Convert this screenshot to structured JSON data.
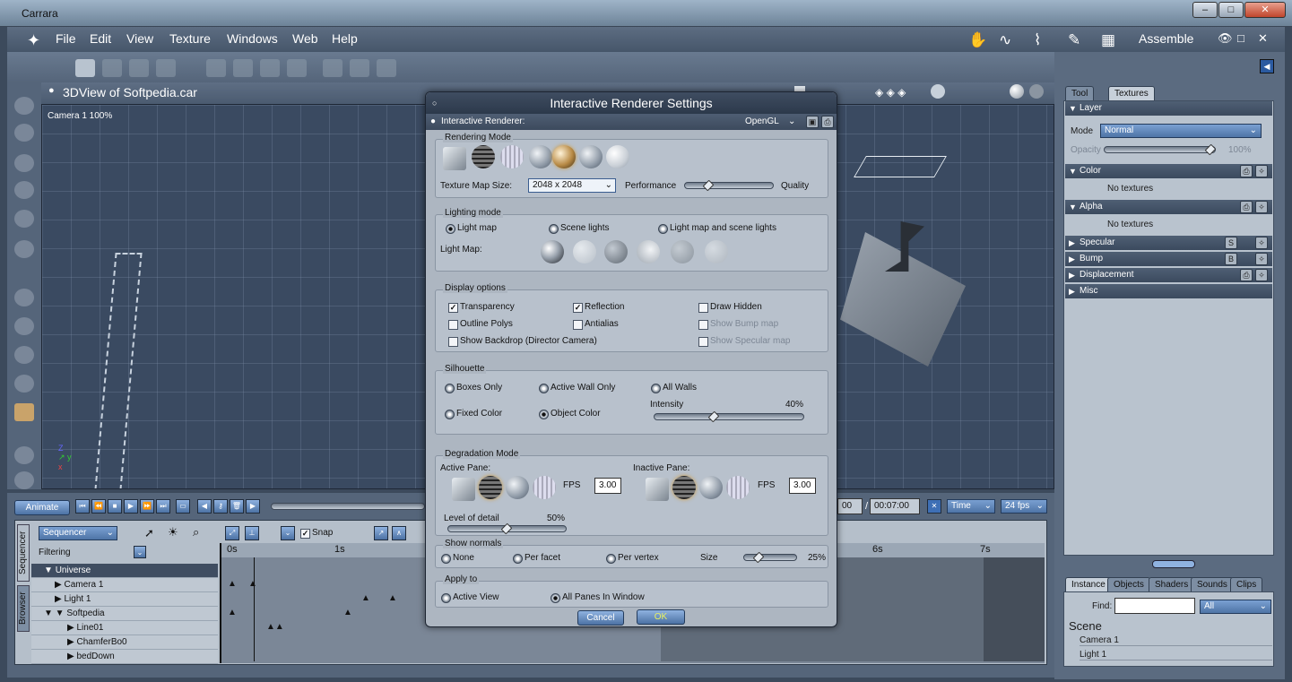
{
  "window": {
    "title": "Carrara",
    "min": "–",
    "max": "□",
    "close": "✕"
  },
  "menu": [
    "File",
    "Edit",
    "View",
    "Texture",
    "Windows",
    "Web",
    "Help"
  ],
  "room": {
    "label": "Assemble"
  },
  "view": {
    "title": "3DView of Softpedia.car",
    "camera": "Camera 1 100%"
  },
  "dialog": {
    "title": "Interactive Renderer Settings",
    "renderer_label": "Interactive Renderer:",
    "renderer_value": "OpenGL",
    "rendering_mode": {
      "label": "Rendering Mode",
      "texture_map_label": "Texture Map Size:",
      "texture_map_value": "2048 x  2048",
      "performance": "Performance",
      "quality": "Quality"
    },
    "lighting": {
      "label": "Lighting mode",
      "opt1": "Light map",
      "opt2": "Scene lights",
      "opt3": "Light map and scene lights",
      "lightmap_label": "Light Map:"
    },
    "display": {
      "label": "Display options",
      "transparency": "Transparency",
      "reflection": "Reflection",
      "draw_hidden": "Draw Hidden",
      "outline_polys": "Outline Polys",
      "antialias": "Antialias",
      "show_bump": "Show Bump map",
      "show_backdrop": "Show Backdrop (Director Camera)",
      "show_specular": "Show Specular map"
    },
    "silhouette": {
      "label": "Silhouette",
      "boxes_only": "Boxes Only",
      "active_wall": "Active Wall Only",
      "all_walls": "All Walls",
      "fixed_color": "Fixed Color",
      "object_color": "Object Color",
      "intensity_label": "Intensity",
      "intensity_value": "40%",
      "intensity": 0.4
    },
    "degradation": {
      "label": "Degradation Mode",
      "active_pane": "Active Pane:",
      "inactive_pane": "Inactive Pane:",
      "fps_label": "FPS",
      "fps_active": "3.00",
      "fps_inactive": "3.00",
      "lod_label": "Level of detail",
      "lod_value": "50%",
      "lod": 0.5
    },
    "normals": {
      "label": "Show normals",
      "none": "None",
      "per_facet": "Per facet",
      "per_vertex": "Per vertex",
      "size_label": "Size",
      "size_value": "25%",
      "size": 0.25
    },
    "apply": {
      "label": "Apply to",
      "active_view": "Active View",
      "all_panes": "All Panes In Window"
    },
    "cancel": "Cancel",
    "ok": "OK"
  },
  "texture_panel": {
    "tabs": [
      "Tool",
      "Textures"
    ],
    "layer": "Layer",
    "mode_label": "Mode",
    "mode_value": "Normal",
    "opacity_label": "Opacity",
    "opacity_value": "100%",
    "color": "Color",
    "alpha": "Alpha",
    "no_textures": "No textures",
    "specular": "Specular",
    "bump": "Bump",
    "displacement": "Displacement",
    "misc": "Misc",
    "specular_key": "S",
    "bump_key": "B"
  },
  "instance_panel": {
    "tabs": [
      "Instance",
      "Objects",
      "Shaders",
      "Sounds",
      "Clips"
    ],
    "find_label": "Find:",
    "find_value": "",
    "filter": "All",
    "scene_title": "Scene",
    "items": [
      "Camera 1",
      "Light 1"
    ]
  },
  "timeline": {
    "animate": "Animate",
    "sequencer": "Sequencer",
    "filtering": "Filtering",
    "snap": "Snap",
    "time_a": "00",
    "time_b": "00:07:00",
    "time_mode": "Time",
    "fps": "24 fps",
    "ruler": [
      "0s",
      "1s",
      "6s",
      "7s"
    ],
    "side_tabs": [
      "Sequencer",
      "Browser"
    ],
    "tree": [
      "Universe",
      "Camera 1",
      "Light 1",
      "Softpedia",
      "Line01",
      "ChamferBo0",
      "bedDown"
    ]
  }
}
